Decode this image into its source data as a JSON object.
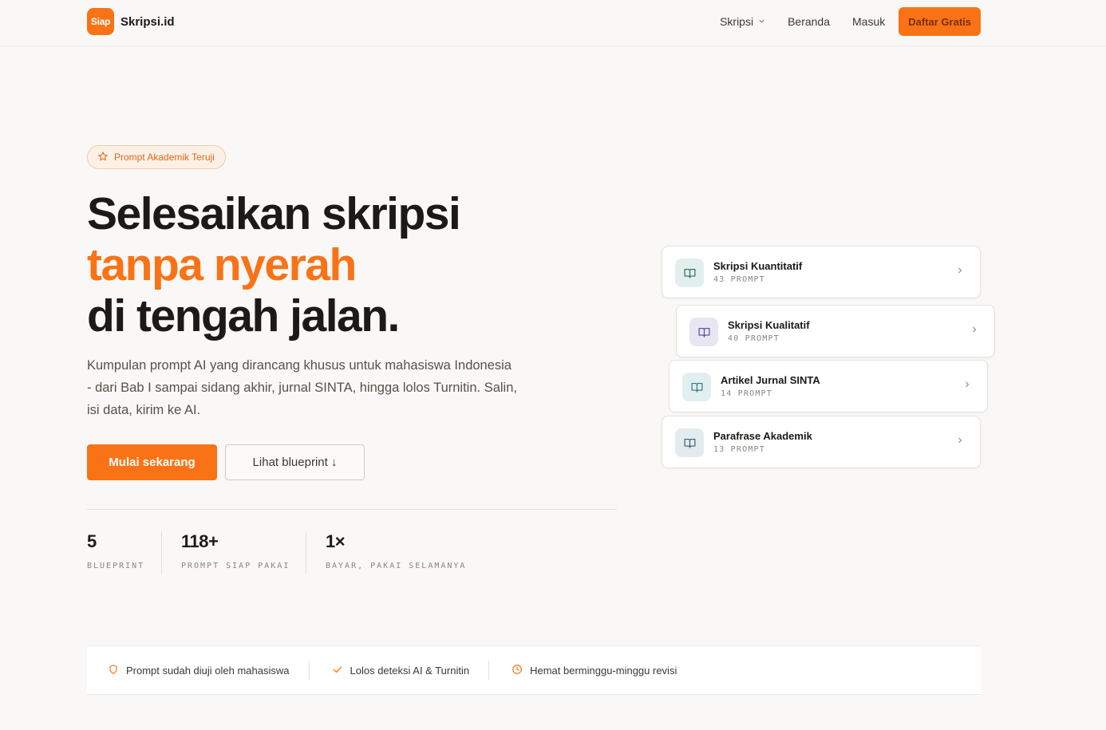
{
  "header": {
    "logo_badge": "Siap",
    "logo_text": "Skripsi.id",
    "nav": [
      {
        "label": "Skripsi"
      },
      {
        "label": "Beranda"
      },
      {
        "label": "Masuk"
      }
    ],
    "cta": "Daftar Gratis"
  },
  "hero": {
    "badge": "Prompt Akademik Teruji",
    "title_line1": "Selesaikan skripsi",
    "title_line2": "tanpa nyerah",
    "title_line3": "di tengah jalan.",
    "description": "Kumpulan prompt AI yang dirancang khusus untuk mahasiswa Indonesia - dari Bab I sampai sidang akhir, jurnal SINTA, hingga lolos Turnitin. Salin, isi data, kirim ke AI.",
    "primary_button": "Mulai sekarang",
    "secondary_button": "Lihat blueprint ↓",
    "stats": [
      {
        "value": "5",
        "label": "BLUEPRINT"
      },
      {
        "value": "118+",
        "label": "PROMPT SIAP PAKAI"
      },
      {
        "value": "1×",
        "label": "BAYAR, PAKAI SELAMANYA"
      }
    ]
  },
  "cards": [
    {
      "title": "Skripsi Kuantitatif",
      "count": "43 PROMPT",
      "icon": "book-open-icon",
      "icon_bg": "#e3efec",
      "icon_color": "#2f6b5c"
    },
    {
      "title": "Skripsi Kualitatif",
      "count": "40 PROMPT",
      "icon": "book-open-icon",
      "icon_bg": "#e9e6f3",
      "icon_color": "#5a4a9a"
    },
    {
      "title": "Artikel Jurnal SINTA",
      "count": "14 PROMPT",
      "icon": "book-open-icon",
      "icon_bg": "#e1eff1",
      "icon_color": "#2d7a86"
    },
    {
      "title": "Parafrase Akademik",
      "count": "13 PROMPT",
      "icon": "book-open-icon",
      "icon_bg": "#e3ebef",
      "icon_color": "#3c5f73"
    }
  ],
  "trust": [
    {
      "label": "Prompt sudah diuji oleh mahasiswa",
      "icon": "shield-icon"
    },
    {
      "label": "Lolos deteksi AI & Turnitin",
      "icon": "check-icon"
    },
    {
      "label": "Hemat berminggu-minggu revisi",
      "icon": "clock-icon"
    }
  ],
  "colors": {
    "accent": "#f97316",
    "background": "#f9f8f6",
    "text": "#1c1a17"
  }
}
